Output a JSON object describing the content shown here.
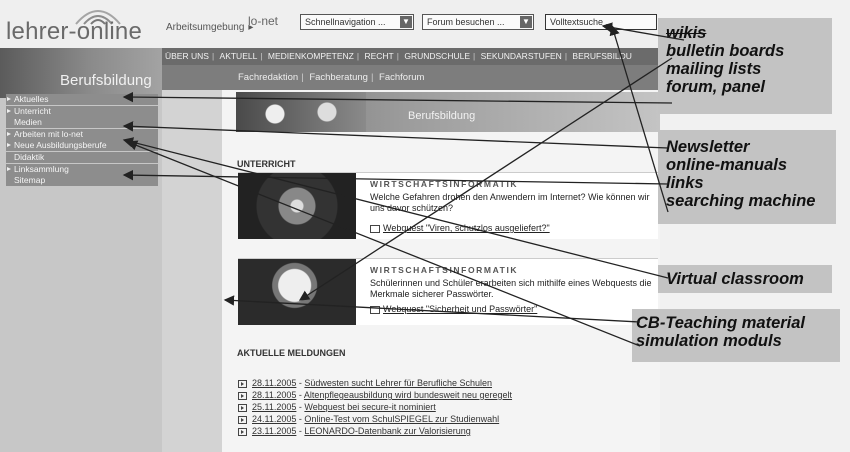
{
  "header": {
    "logo_text": "lehrer-online",
    "breadcrumb": "Arbeitsumgebung",
    "breadcrumb_sep": "▸",
    "network_logo": "lo-net",
    "selects": {
      "quicknav": "Schnellnavigation ...",
      "forum": "Forum besuchen ...",
      "fulltext": "Volltextsuche ..."
    }
  },
  "topnav": {
    "items": [
      "ÜBER UNS",
      "AKTUELL",
      "MEDIENKOMPETENZ",
      "RECHT",
      "GRUNDSCHULE",
      "SEKUNDARSTUFEN",
      "BERUFSBILDU"
    ]
  },
  "banner": {
    "title": "Berufsbildung"
  },
  "subnav": {
    "items": [
      "Fachredaktion",
      "Fachberatung",
      "Fachforum"
    ]
  },
  "sidebar": {
    "items": [
      "Aktuelles",
      "Unterricht",
      "Medien",
      "Arbeiten mit lo-net",
      "Neue Ausbildungsberufe",
      "Didaktik",
      "Linksammlung",
      "Sitemap"
    ]
  },
  "content": {
    "banner2_title": "Berufsbildung",
    "unterricht_heading": "UNTERRICHT",
    "cards": [
      {
        "title": "WIRTSCHAFTSINFORMATIK",
        "text": "Welche Gefahren drohen den Anwendern im Internet? Wie können wir uns davor schützen?",
        "link": "Webquest \"Viren, schutzlos ausgeliefert?\""
      },
      {
        "title": "WIRTSCHAFTSINFORMATIK",
        "text": "Schülerinnen und Schüler erarbeiten sich mithilfe eines Webquests die Merkmale sicherer Passwörter.",
        "link": "Webquest \"Sicherheit und Passwörter\""
      }
    ],
    "news_heading": "AKTUELLE MELDUNGEN",
    "news": [
      {
        "date": "28.11.2005",
        "text": "Südwesten sucht Lehrer für Berufliche Schulen"
      },
      {
        "date": "28.11.2005",
        "text": "Altenpflegeausbildung wird bundesweit neu geregelt"
      },
      {
        "date": "25.11.2005",
        "text": "Webquest bei secure-it nominiert"
      },
      {
        "date": "24.11.2005",
        "text": "Online-Test vom SchulSPIEGEL zur Studienwahl"
      },
      {
        "date": "23.11.2005",
        "text": "LEONARDO-Datenbank zur Valorisierung"
      }
    ]
  },
  "callouts": [
    {
      "lines": [
        "wikis",
        "bulletin boards",
        "mailing lists",
        "forum, panel"
      ]
    },
    {
      "lines": [
        "Newsletter",
        "online-manuals",
        "links",
        "searching machine"
      ]
    },
    {
      "lines": [
        "Virtual classroom"
      ]
    },
    {
      "lines": [
        "CB-Teaching material",
        "simulation moduls"
      ]
    }
  ],
  "colors": {
    "callout_bg": "#c3c3c3",
    "nav_bg": "#6b6b6b",
    "sidebar_item_bg": "#8d8d8d"
  }
}
